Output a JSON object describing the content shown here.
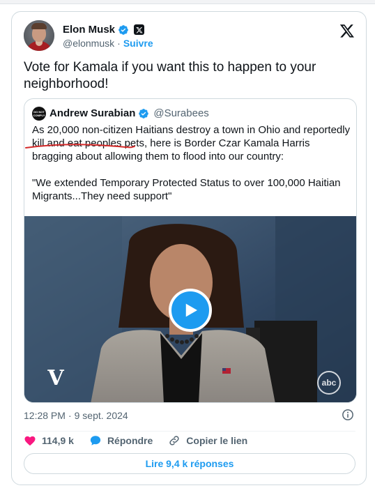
{
  "author": {
    "name": "Elon Musk",
    "handle": "@elonmusk",
    "separator": "·",
    "follow_label": "Suivre"
  },
  "tweet_text": "Vote for Kamala if you want this to happen to your neighborhood!",
  "quoted": {
    "avatar_text": "DO NOT COMPLY",
    "name": "Andrew Surabian",
    "handle": "@Surabees",
    "paragraph1": "As 20,000 non-citizen Haitians destroy a town in Ohio and reportedly kill and eat peoples pets, here is Border Czar Kamala Harris bragging about allowing them to flood into our country:",
    "paragraph2": "\"We extended Temporary Protected Status to over 100,000 Haitian Migrants...They need support\"",
    "video": {
      "network_logo": "abc",
      "show_logo": "V"
    }
  },
  "meta": {
    "time": "12:28 PM",
    "separator": "·",
    "date": "9 sept. 2024"
  },
  "actions": {
    "likes": "114,9 k",
    "reply_label": "Répondre",
    "copy_label": "Copier le lien"
  },
  "read_replies_label": "Lire 9,4 k réponses",
  "colors": {
    "accent": "#1d9bf0",
    "like": "#f91880",
    "text": "#0f1419",
    "secondary": "#536471",
    "border": "#cfd9de"
  }
}
